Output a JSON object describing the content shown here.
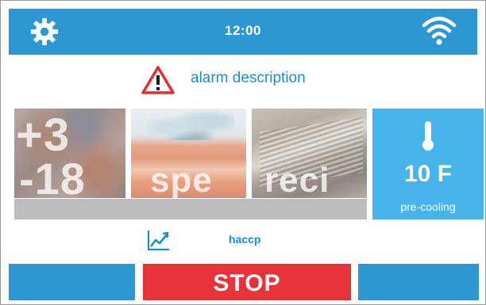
{
  "header": {
    "time": "12:00",
    "settings_icon": "gear-icon",
    "connectivity_icon": "wifi-icon"
  },
  "alarm": {
    "icon": "warning-triangle-icon",
    "text": "alarm description"
  },
  "tiles": [
    {
      "label_top": "+3",
      "label_bottom": "-18",
      "image": "frozen-meat"
    },
    {
      "label": "spe",
      "image": "food-ice"
    },
    {
      "label": "reci",
      "image": "open-book"
    }
  ],
  "status_tile": {
    "icon": "thermometer-icon",
    "temperature": "10 F",
    "mode": "pre-cooling"
  },
  "haccp": {
    "icon": "trend-chart-icon",
    "label": "haccp"
  },
  "bottom": {
    "stop_label": "STOP"
  },
  "colors": {
    "primary_blue": "#2c97d3",
    "status_blue": "#46b4ea",
    "stop_red": "#e8323a",
    "text_blue": "#1a8fcf",
    "warning_red": "#e0302b"
  }
}
